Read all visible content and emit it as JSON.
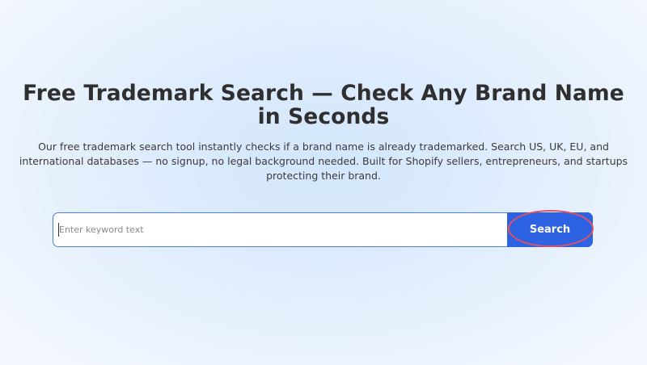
{
  "hero": {
    "title": "Free Trademark Search — Check Any Brand Name in Seconds",
    "description": "Our free trademark search tool instantly checks if a brand name is already trademarked. Search US, UK, EU, and international databases — no signup, no legal background needed. Built for Shopify sellers, entrepreneurs, and startups protecting their brand."
  },
  "search": {
    "placeholder": "Enter keyword text",
    "value": "",
    "button_label": "Search"
  },
  "colors": {
    "accent": "#2d62e3",
    "highlight": "#de5462"
  }
}
